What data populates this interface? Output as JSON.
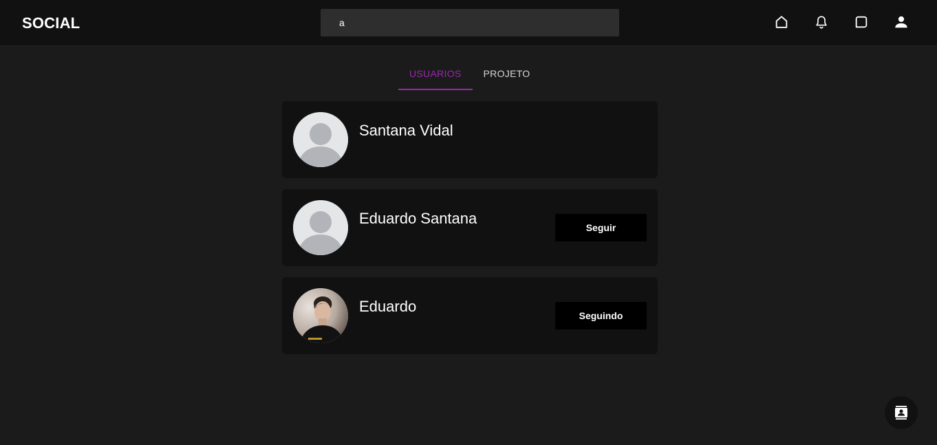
{
  "app": {
    "brand": "SOCIAL"
  },
  "search": {
    "value": "a"
  },
  "nav": {
    "icons": [
      "home-icon",
      "bell-icon",
      "chat-icon",
      "person-icon"
    ]
  },
  "tabs": [
    {
      "label": "USUARIOS",
      "active": true
    },
    {
      "label": "PROJETO",
      "active": false
    }
  ],
  "results": [
    {
      "name": "Santana Vidal",
      "button": "",
      "avatar": "default"
    },
    {
      "name": "Eduardo Santana",
      "button": "Seguir",
      "avatar": "default"
    },
    {
      "name": "Eduardo",
      "button": "Seguindo",
      "avatar": "photo"
    }
  ],
  "fab": {
    "icon": "contacts-icon"
  },
  "colors": {
    "accent": "#9c27b0",
    "background": "#1b1b1b",
    "surface": "#111111"
  }
}
